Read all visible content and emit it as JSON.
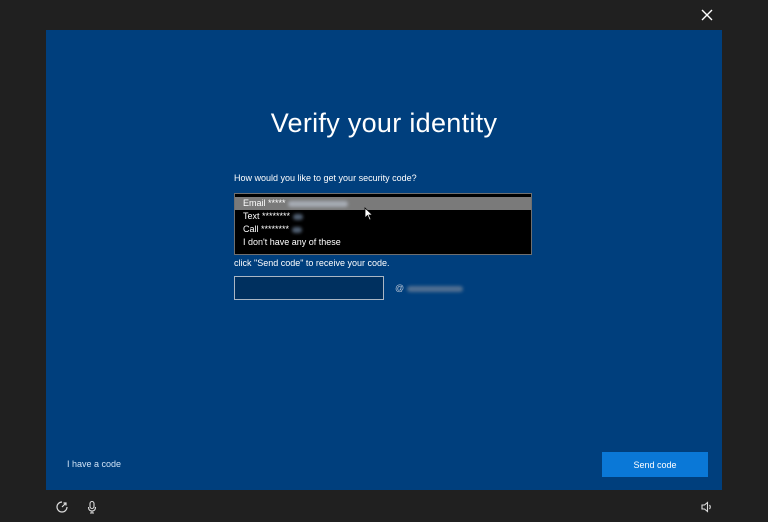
{
  "title": "Verify your identity",
  "question": "How would you like to get your security code?",
  "options": [
    {
      "label": "Email ",
      "masked": "*****"
    },
    {
      "label": "Text ",
      "masked": "********"
    },
    {
      "label": "Call ",
      "masked": "********"
    },
    {
      "label": "I don't have any of these",
      "masked": ""
    }
  ],
  "selected_option": "Email",
  "hint": "click \"Send code\" to receive your code.",
  "code_input": {
    "value": "",
    "placeholder": ""
  },
  "email_prefix": "@",
  "have_code_label": "I have a code",
  "send_button_label": "Send code",
  "icons": {
    "close": "close-icon",
    "accessibility": "ease-of-access-icon",
    "microphone": "microphone-icon",
    "volume": "volume-icon",
    "cursor": "mouse-pointer-icon"
  },
  "colors": {
    "panel": "#003f7d",
    "frame": "#202020",
    "accent": "#0a78d7"
  }
}
